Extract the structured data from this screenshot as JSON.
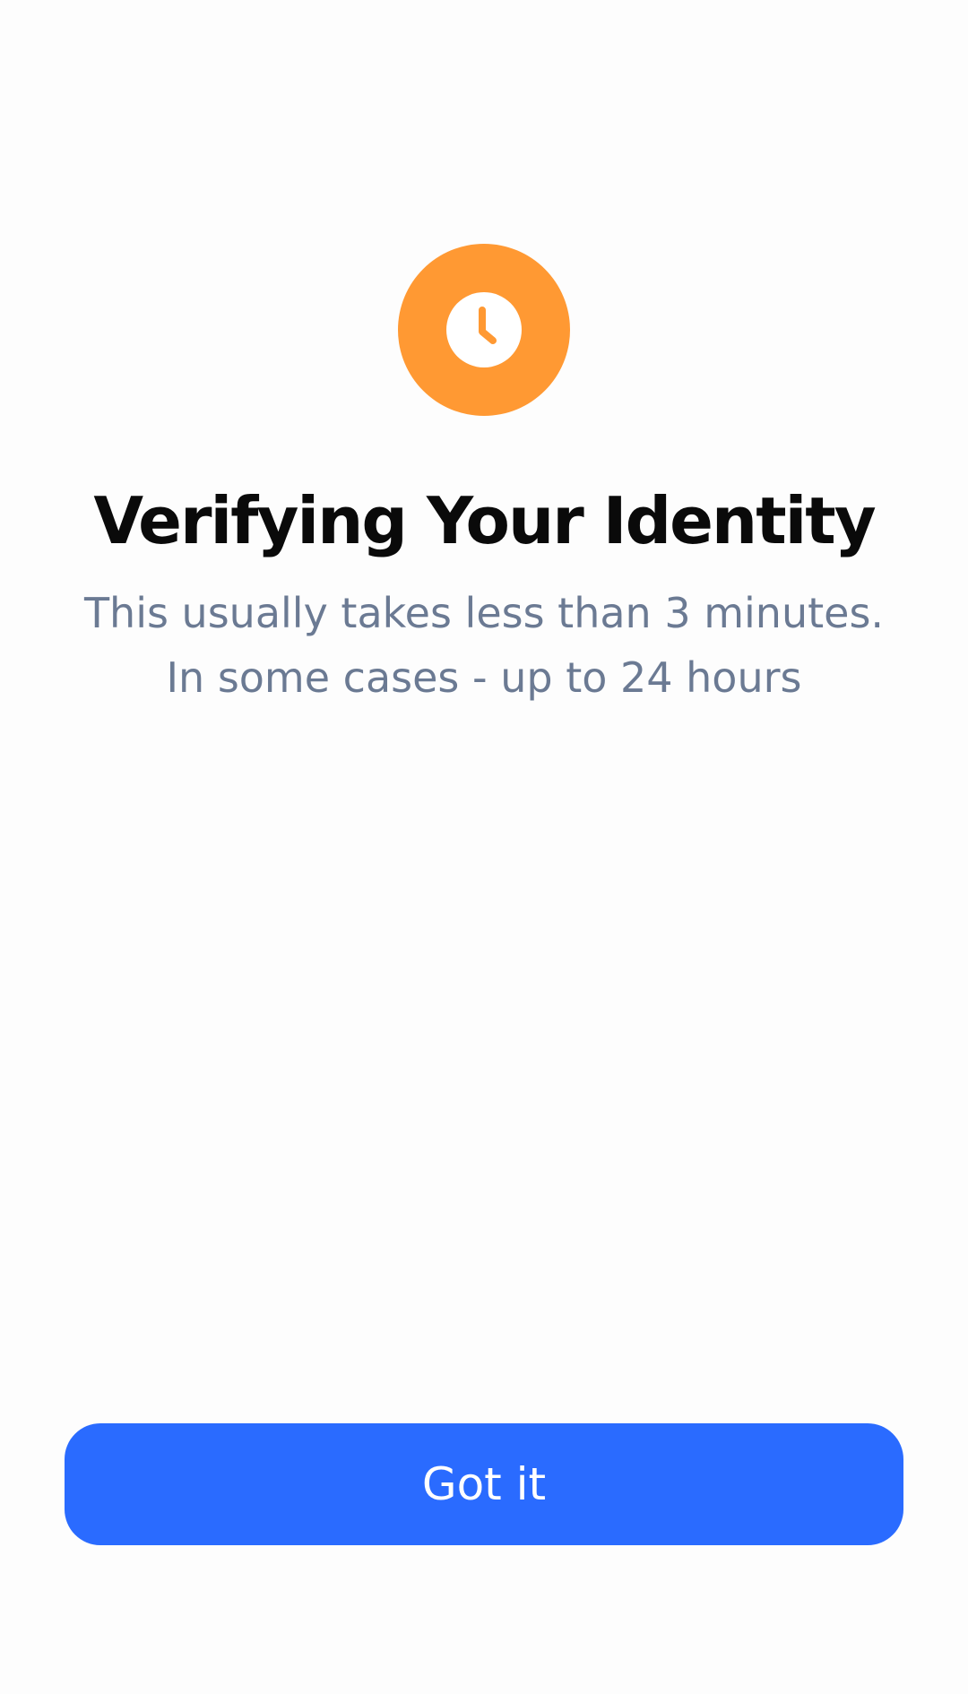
{
  "status": {
    "icon": "clock-icon",
    "badge_color": "#ff9933"
  },
  "title": "Verifying Your Identity",
  "subtitle": {
    "line1": "This usually takes less than 3 minutes.",
    "line2": "In some cases - up to 24 hours"
  },
  "actions": {
    "primary_label": "Got it",
    "primary_color": "#2a6bff"
  }
}
